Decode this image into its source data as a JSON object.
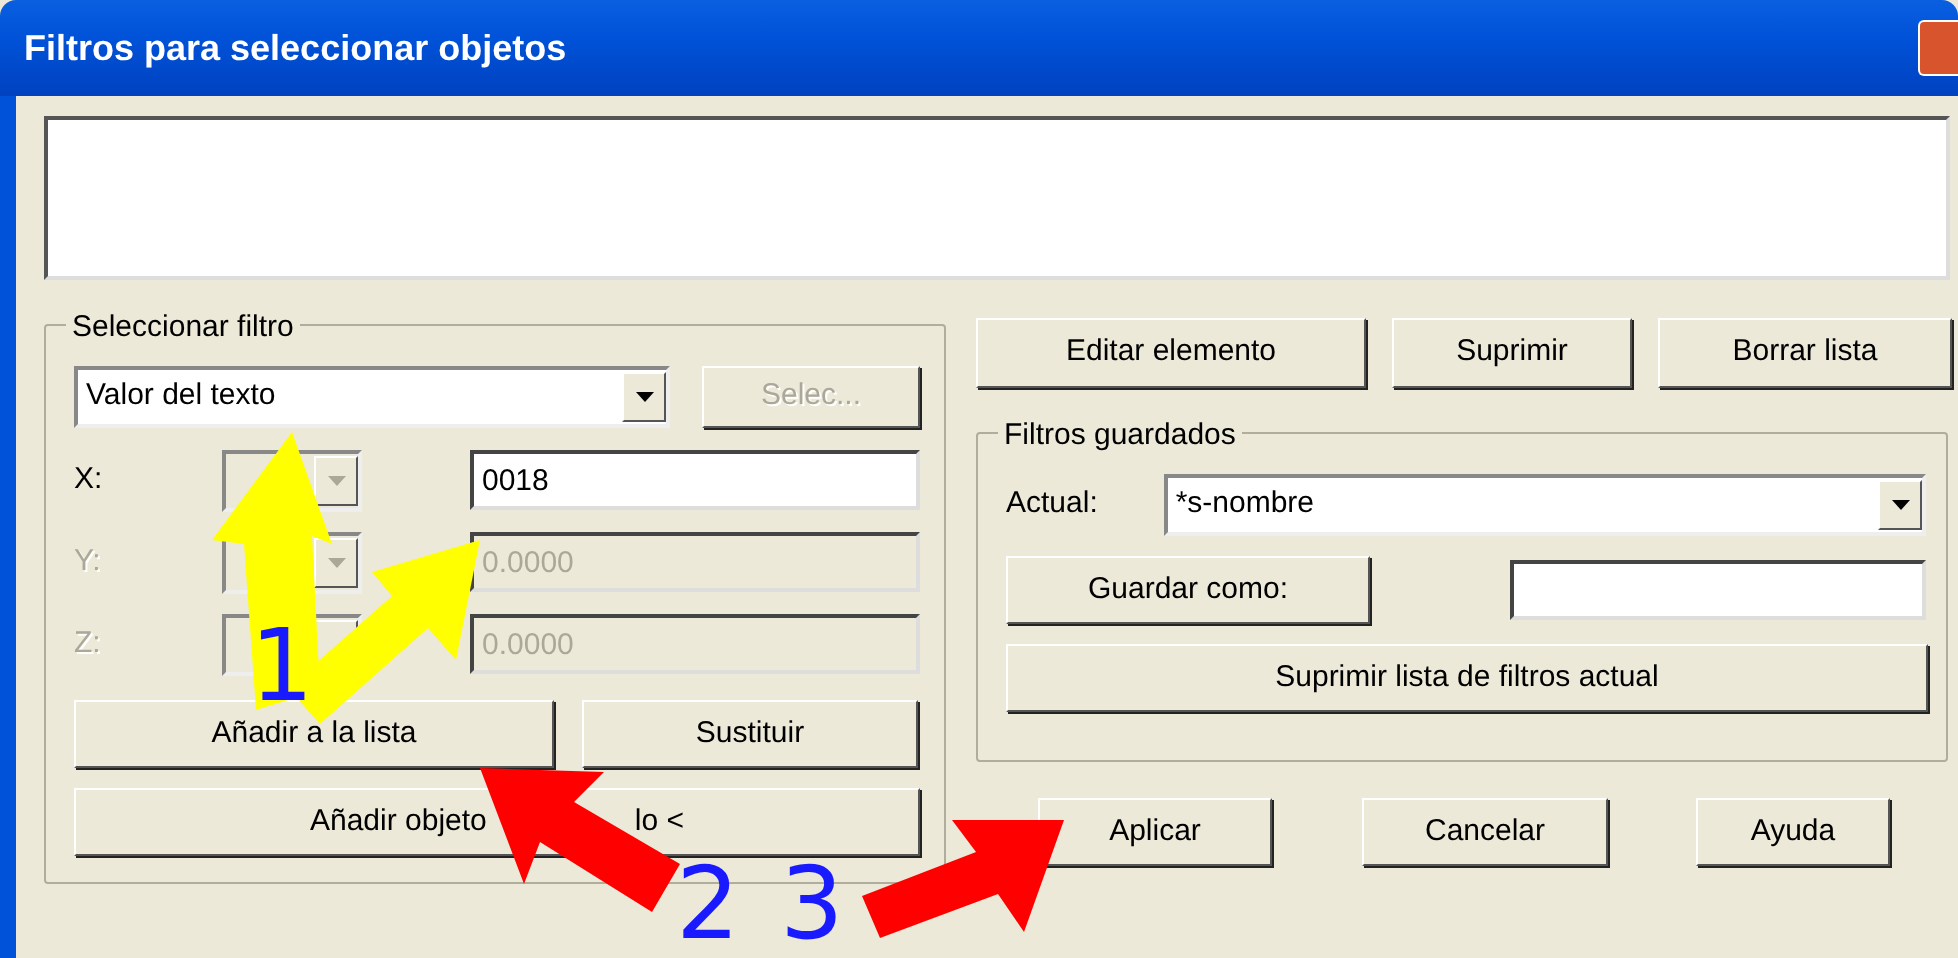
{
  "window": {
    "title": "Filtros para seleccionar objetos"
  },
  "select_filter": {
    "legend": "Seleccionar filtro",
    "filter_type": "Valor del texto",
    "select_button": {
      "label": "Selec...",
      "disabled": true
    },
    "coordinates": [
      {
        "label": "X:",
        "value": "0018",
        "disabled": false
      },
      {
        "label": "Y:",
        "value": "0.0000",
        "disabled": true
      },
      {
        "label": "Z:",
        "value": "0.0000",
        "disabled": true
      }
    ],
    "add_button": "Añadir a la lista",
    "replace_button": "Sustituir",
    "add_object_button": {
      "label_parts": [
        "Añadir objeto",
        "lo <"
      ]
    }
  },
  "list_buttons": [
    "Editar elemento",
    "Suprimir",
    "Borrar lista"
  ],
  "saved_filters": {
    "legend": "Filtros guardados",
    "current_label": "Actual:",
    "current_value": "*s-nombre",
    "save_as_button": "Guardar como:",
    "delete_button": "Suprimir lista de filtros actual"
  },
  "dialog_buttons": [
    "Aplicar",
    "Cancelar",
    "Ayuda"
  ],
  "annotations": [
    {
      "number": "1",
      "color": "#ffff00"
    },
    {
      "number": "2",
      "color": "#ff0000"
    },
    {
      "number": "3",
      "color": "#ff0000"
    }
  ]
}
